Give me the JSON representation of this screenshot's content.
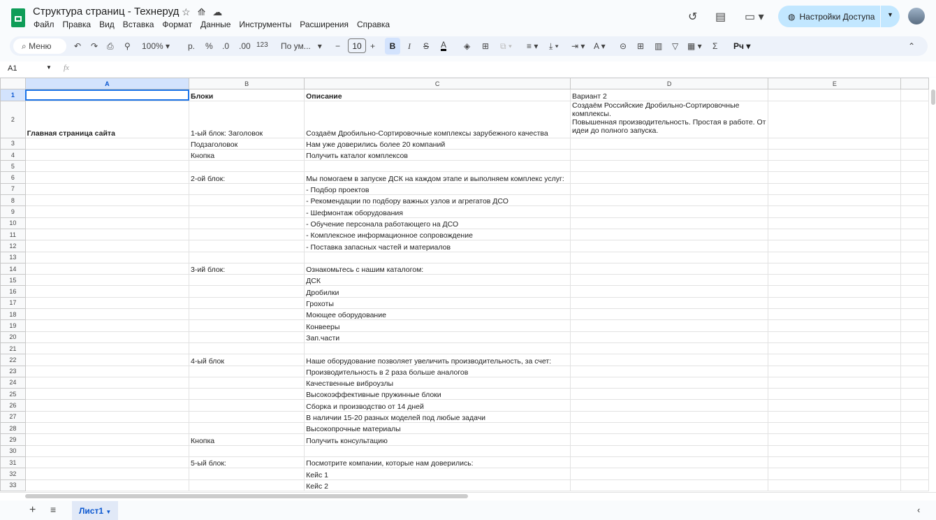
{
  "doc": {
    "title": "Структура страниц - Технеруд",
    "menu": [
      "Файл",
      "Правка",
      "Вид",
      "Вставка",
      "Формат",
      "Данные",
      "Инструменты",
      "Расширения",
      "Справка"
    ],
    "share_label": "Настройки Доступа"
  },
  "toolbar": {
    "search": "Меню",
    "zoom": "100%",
    "currency": "р.",
    "percent": "%",
    "dec_less": ".0",
    "dec_more": ".00",
    "format123": "123",
    "font": "По ум...",
    "font_size": "10",
    "bold": "B",
    "italic": "I",
    "input_tools": "Pч"
  },
  "formula": {
    "cell_ref": "A1",
    "fx": "fx",
    "value": ""
  },
  "columns": [
    "A",
    "B",
    "C",
    "D",
    "E",
    ""
  ],
  "rows": [
    [
      "",
      "Блоки",
      "Описание",
      "Вариант 2"
    ],
    [
      "Главная страница сайта",
      "1-ый блок: Заголовок",
      "Создаём Дробильно-Сортировочные комплексы зарубежного качества",
      "Создаём Российские Дробильно-Сортировочные комплексы.\nПовышенная производительность. Простая в работе. От идеи до полного запуска."
    ],
    [
      "",
      "Подзаголовок",
      "Нам уже доверились более 20 компаний",
      ""
    ],
    [
      "",
      "Кнопка",
      "Получить каталог комплексов",
      ""
    ],
    [
      "",
      "",
      "",
      ""
    ],
    [
      "",
      "2-ой блок:",
      "Мы помогаем в запуске ДСК на каждом этапе и выполняем комплекс услуг:",
      ""
    ],
    [
      "",
      "",
      "- Подбор проектов",
      ""
    ],
    [
      "",
      "",
      "- Рекомендации по подбору важных узлов и агрегатов ДСО",
      ""
    ],
    [
      "",
      "",
      "- Шефмонтаж оборудования",
      ""
    ],
    [
      "",
      "",
      "- Обучение персонала работающего на ДСО",
      ""
    ],
    [
      "",
      "",
      "- Комплексное информационное сопровождение",
      ""
    ],
    [
      "",
      "",
      "- Поставка запасных частей и материалов",
      ""
    ],
    [
      "",
      "",
      "",
      ""
    ],
    [
      "",
      "3-ий блок:",
      "Ознакомьтесь с нашим каталогом:",
      ""
    ],
    [
      "",
      "",
      "ДСК",
      ""
    ],
    [
      "",
      "",
      "Дробилки",
      ""
    ],
    [
      "",
      "",
      "Грохоты",
      ""
    ],
    [
      "",
      "",
      "Моющее оборудование",
      ""
    ],
    [
      "",
      "",
      "Конвееры",
      ""
    ],
    [
      "",
      "",
      "Зап.части",
      ""
    ],
    [
      "",
      "",
      "",
      ""
    ],
    [
      "",
      "4-ый блок",
      "Наше оборудование позволяет увеличить производительность, за счет:",
      ""
    ],
    [
      "",
      "",
      "Производительность в 2 раза больше аналогов",
      ""
    ],
    [
      "",
      "",
      "Качественные виброузлы",
      ""
    ],
    [
      "",
      "",
      "Высокоэффективные пружинные блоки",
      ""
    ],
    [
      "",
      "",
      "Сборка и производство от 14 дней",
      ""
    ],
    [
      "",
      "",
      "В наличии 15-20 разных моделей под любые задачи",
      ""
    ],
    [
      "",
      "",
      "Высокопрочные материалы",
      ""
    ],
    [
      "",
      "Кнопка",
      "Получить консультацию",
      ""
    ],
    [
      "",
      "",
      "",
      ""
    ],
    [
      "",
      "5-ый блок:",
      "Посмотрите компании, которые нам доверились:",
      ""
    ],
    [
      "",
      "",
      "Кейс 1",
      ""
    ],
    [
      "",
      "",
      "Кейс 2",
      ""
    ]
  ],
  "sheets": [
    {
      "label": "Лист1"
    }
  ]
}
